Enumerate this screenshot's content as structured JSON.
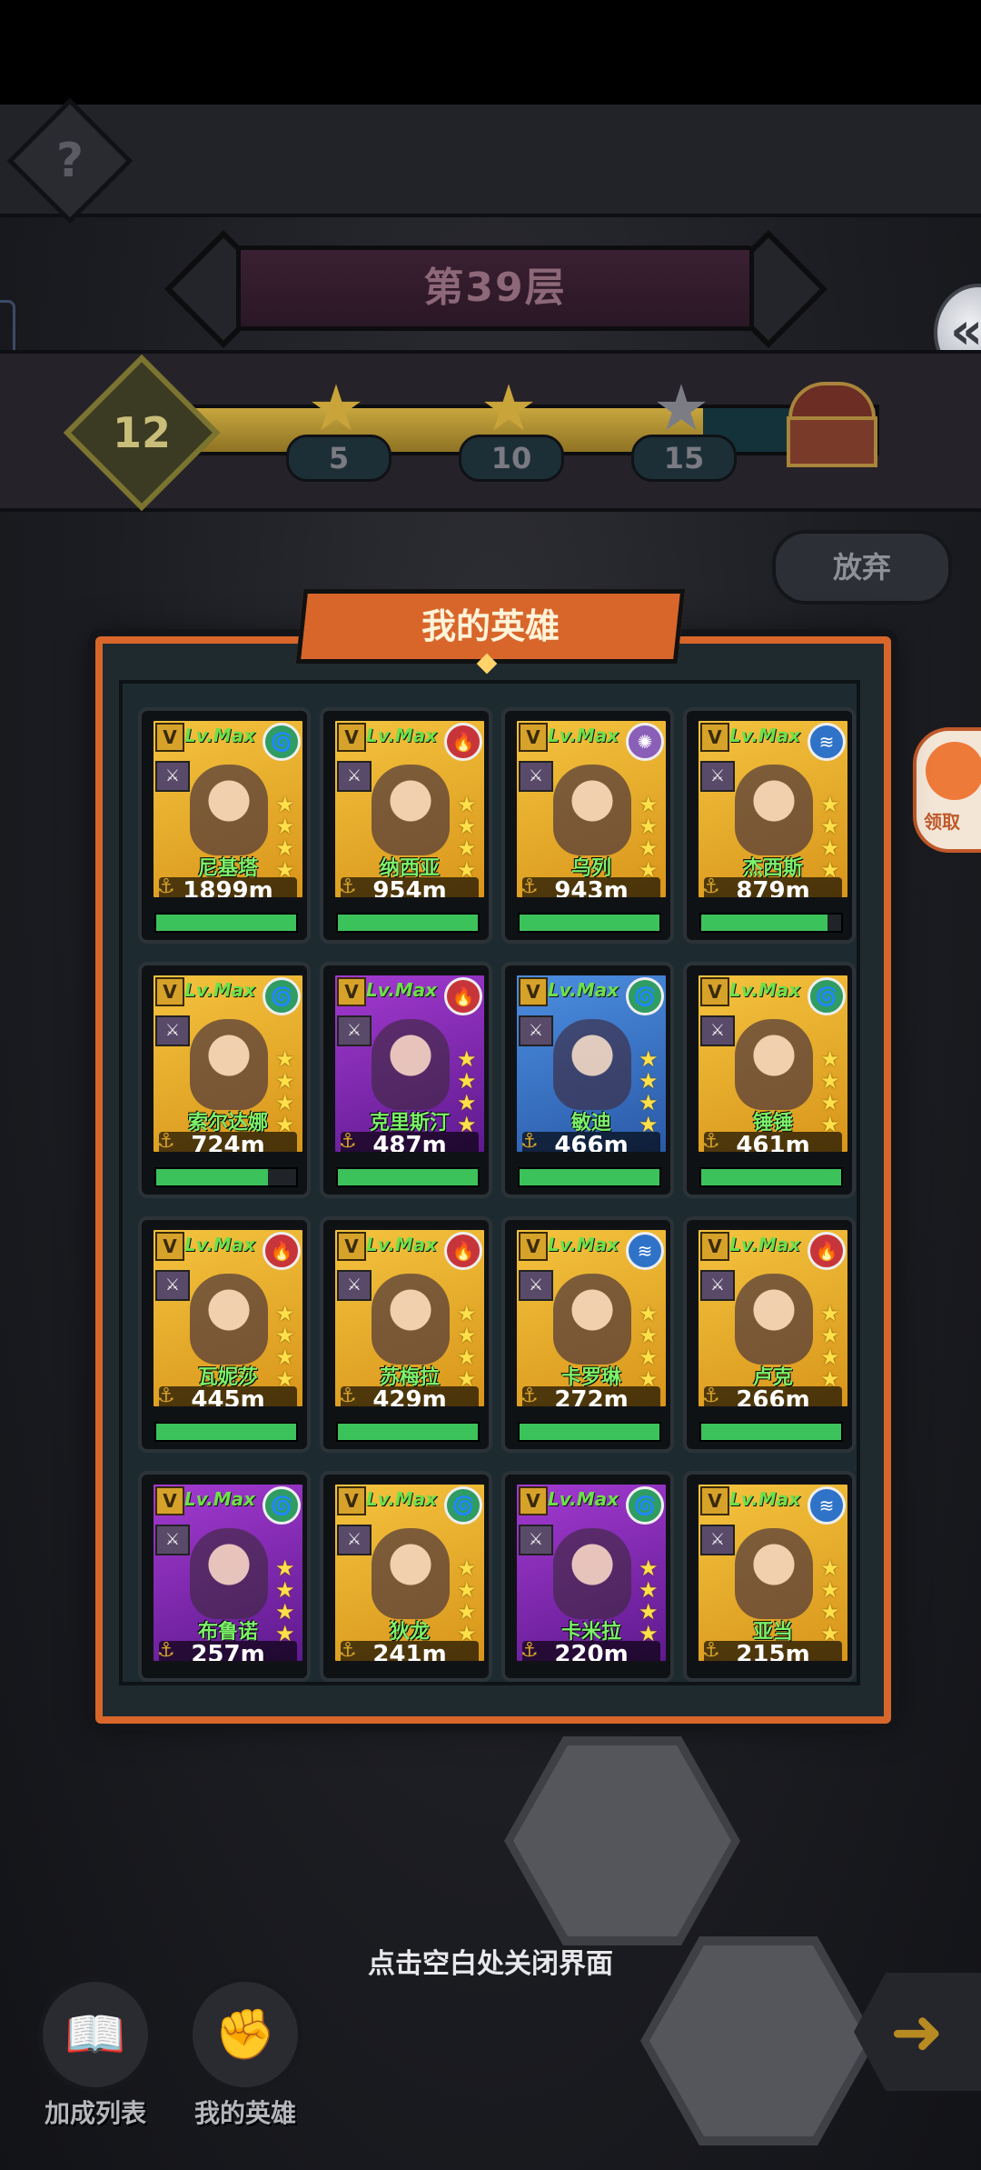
{
  "floor": {
    "title": "第39层"
  },
  "progress": {
    "level": "12",
    "fill_fraction": 0.75,
    "milestones": [
      {
        "value": "5",
        "achieved": true
      },
      {
        "value": "10",
        "achieved": true
      },
      {
        "value": "15",
        "achieved": false
      }
    ]
  },
  "abandon_label": "放弃",
  "side_claim_label": "领取",
  "panel": {
    "title": "我的英雄"
  },
  "heroes": [
    {
      "name": "尼基塔",
      "distance": "1899m",
      "level": "Lv.Max",
      "element": "wind",
      "bg": "gold",
      "hp": 1.0
    },
    {
      "name": "纳西亚",
      "distance": "954m",
      "level": "Lv.Max",
      "element": "fire",
      "bg": "gold",
      "hp": 1.0
    },
    {
      "name": "乌列",
      "distance": "943m",
      "level": "Lv.Max",
      "element": "light",
      "bg": "gold",
      "hp": 1.0
    },
    {
      "name": "杰西斯",
      "distance": "879m",
      "level": "Lv.Max",
      "element": "water",
      "bg": "gold",
      "hp": 0.9
    },
    {
      "name": "索尔达娜",
      "distance": "724m",
      "level": "Lv.Max",
      "element": "wind",
      "bg": "gold",
      "hp": 0.8
    },
    {
      "name": "克里斯汀",
      "distance": "487m",
      "level": "Lv.Max",
      "element": "fire",
      "bg": "purple",
      "hp": 1.0
    },
    {
      "name": "敏迪",
      "distance": "466m",
      "level": "Lv.Max",
      "element": "wind",
      "bg": "blue",
      "hp": 1.0
    },
    {
      "name": "锤锤",
      "distance": "461m",
      "level": "Lv.Max",
      "element": "wind",
      "bg": "gold",
      "hp": 1.0
    },
    {
      "name": "瓦妮莎",
      "distance": "445m",
      "level": "Lv.Max",
      "element": "fire",
      "bg": "gold",
      "hp": 1.0
    },
    {
      "name": "苏梅拉",
      "distance": "429m",
      "level": "Lv.Max",
      "element": "fire",
      "bg": "gold",
      "hp": 1.0
    },
    {
      "name": "卡罗琳",
      "distance": "272m",
      "level": "Lv.Max",
      "element": "water",
      "bg": "gold",
      "hp": 1.0
    },
    {
      "name": "卢克",
      "distance": "266m",
      "level": "Lv.Max",
      "element": "fire",
      "bg": "gold",
      "hp": 1.0
    },
    {
      "name": "布鲁诺",
      "distance": "257m",
      "level": "Lv.Max",
      "element": "wind",
      "bg": "purple",
      "hp": null
    },
    {
      "name": "狄龙",
      "distance": "241m",
      "level": "Lv.Max",
      "element": "wind",
      "bg": "gold",
      "hp": null
    },
    {
      "name": "卡米拉",
      "distance": "220m",
      "level": "Lv.Max",
      "element": "wind",
      "bg": "purple",
      "hp": null
    },
    {
      "name": "亚当",
      "distance": "215m",
      "level": "Lv.Max",
      "element": "water",
      "bg": "gold",
      "hp": null
    }
  ],
  "close_hint": "点击空白处关闭界面",
  "dock": {
    "bonus_list_label": "加成列表",
    "my_heroes_label": "我的英雄"
  },
  "icons": {
    "help": "question-mark",
    "back": "double-chevron-left",
    "chest": "treasure-chest",
    "next": "arrow-right"
  }
}
